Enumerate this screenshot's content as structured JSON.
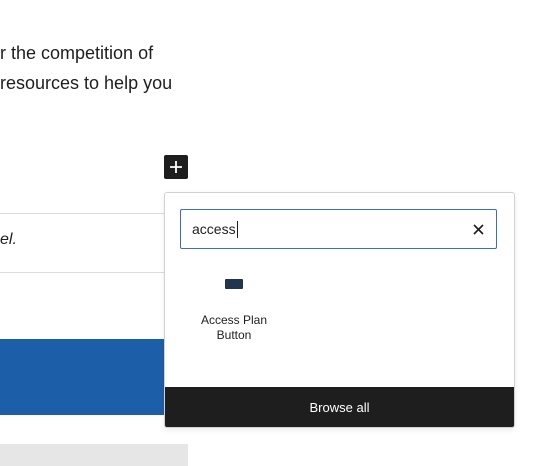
{
  "editor": {
    "paragraph_lines": [
      "r the competition of",
      "resources to help you"
    ],
    "italic_text": "el."
  },
  "inserter": {
    "search": {
      "value": "access",
      "placeholder": ""
    },
    "results": [
      {
        "label_lines": [
          "Access Plan",
          "Button"
        ],
        "icon": "button-icon"
      }
    ],
    "browse_all_label": "Browse all"
  },
  "colors": {
    "accent": "#3d6fb4",
    "dark": "#1e1e1e",
    "blue_band": "#1d5ea8",
    "block_icon": "#21364d"
  }
}
